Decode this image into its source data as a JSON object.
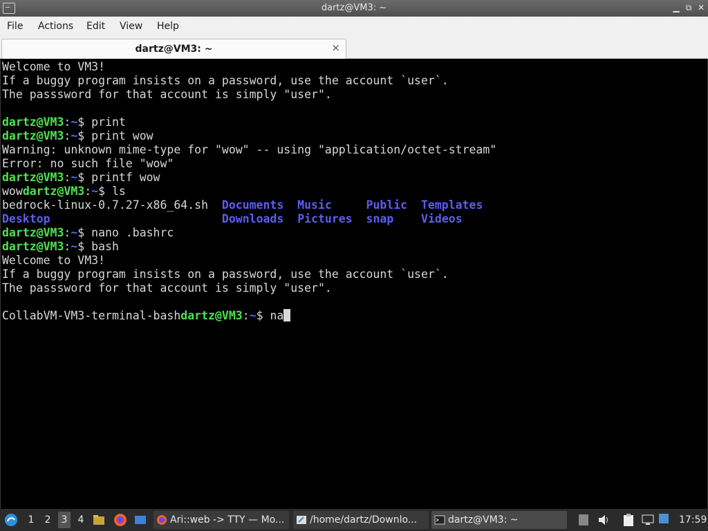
{
  "window": {
    "title": "dartz@VM3: ~"
  },
  "menu": [
    "File",
    "Actions",
    "Edit",
    "View",
    "Help"
  ],
  "tab": {
    "label": "dartz@VM3: ~",
    "close": "×"
  },
  "terminal": {
    "user": "dartz@VM3",
    "path": "~",
    "motd": [
      "Welcome to VM3!",
      "If a buggy program insists on a password, use the account `user`.",
      "The passsword for that account is simply \"user\"."
    ],
    "cmd1": "print",
    "cmd2": "print wow",
    "warn": "Warning: unknown mime-type for \"wow\" -- using \"application/octet-stream\"",
    "err": "Error: no such file \"wow\"",
    "cmd3": "printf wow",
    "wow": "wow",
    "cmd4": "ls",
    "ls": {
      "file": "bedrock-linux-0.7.27-x86_64.sh",
      "dirs_row1": [
        "Documents",
        "Music",
        "Public",
        "Templates"
      ],
      "dirs_row2": [
        "Desktop",
        "Downloads",
        "Pictures",
        "snap",
        "Videos"
      ]
    },
    "cmd5": "nano .bashrc",
    "cmd6": "bash",
    "ps1_prefix": "CollabVM-VM3-terminal-bash",
    "current_input": "na"
  },
  "taskbar": {
    "workspaces": [
      "1",
      "2",
      "3",
      "4"
    ],
    "active_workspace": "3",
    "tasks": [
      {
        "label": "Ari::web -> TTY — Mo...",
        "icon": "firefox-icon"
      },
      {
        "label": "/home/dartz/Downlo...",
        "icon": "text-editor-icon"
      },
      {
        "label": "dartz@VM3: ~",
        "icon": "terminal-icon"
      }
    ],
    "clock": "17:59"
  }
}
